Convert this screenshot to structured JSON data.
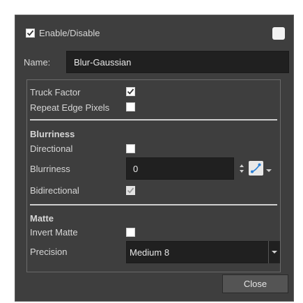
{
  "header": {
    "enable_label": "Enable/Disable",
    "enable_checked": true,
    "color_swatch": "#f2f2f2"
  },
  "name_row": {
    "label": "Name:",
    "value": "Blur-Gaussian"
  },
  "options": {
    "truck_factor": {
      "label": "Truck Factor",
      "checked": true
    },
    "repeat_edge_pixels": {
      "label": "Repeat Edge Pixels",
      "checked": false
    }
  },
  "blurriness_section": {
    "heading": "Blurriness",
    "directional": {
      "label": "Directional",
      "checked": false
    },
    "blurriness": {
      "label": "Blurriness",
      "value": "0"
    },
    "bidirectional": {
      "label": "Bidirectional",
      "checked": true,
      "disabled": true
    }
  },
  "matte_section": {
    "heading": "Matte",
    "invert_matte": {
      "label": "Invert Matte",
      "checked": false
    },
    "precision": {
      "label": "Precision",
      "value": "Medium 8"
    }
  },
  "footer": {
    "close_label": "Close"
  },
  "colors": {
    "dialog_bg": "#3e3e3e",
    "field_bg": "#202020",
    "accent_blue": "#2a7fd4"
  }
}
